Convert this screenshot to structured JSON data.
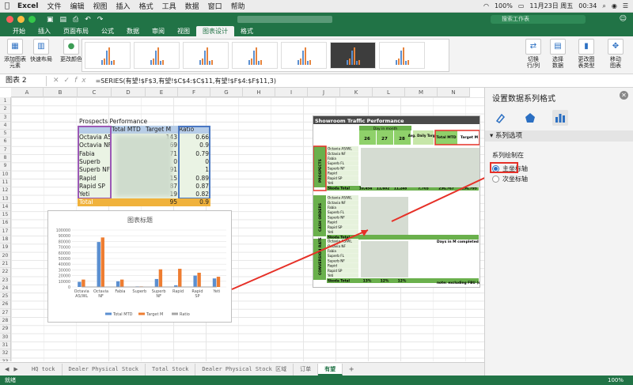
{
  "menubar": {
    "app": "Excel",
    "items": [
      "文件",
      "编辑",
      "视图",
      "插入",
      "格式",
      "工具",
      "数据",
      "窗口",
      "帮助"
    ],
    "battery": "100%",
    "date": "11月23日 周五",
    "time": "00:34"
  },
  "titlebar": {
    "search_placeholder": "搜索工作表"
  },
  "tabs": [
    "开始",
    "插入",
    "页面布局",
    "公式",
    "数据",
    "审阅",
    "视图",
    "图表设计",
    "格式"
  ],
  "active_tab": "图表设计",
  "ribbon": {
    "add_element": "添加图表\n元素",
    "quick_layout": "快速布局",
    "change_colors": "更改颜色",
    "switch_rowcol": "切换\n行/列",
    "select_data": "选择\n数据",
    "change_type": "更改图\n表类型",
    "move_chart": "移动\n图表"
  },
  "formula_bar": {
    "name_box": "图表 2",
    "formula": "=SERIES(有望!$F$3,有望!$C$4:$C$11,有望!$F$4:$F$11,3)"
  },
  "columns": [
    "A",
    "B",
    "C",
    "D",
    "E",
    "F",
    "G",
    "H",
    "I",
    "J",
    "K",
    "L",
    "M",
    "N"
  ],
  "rows": [
    "1",
    "2",
    "3",
    "4",
    "5",
    "6",
    "7",
    "8",
    "9",
    "10",
    "11",
    "12",
    "13",
    "14",
    "15",
    "16",
    "17",
    "18",
    "19",
    "20",
    "21",
    "22",
    "23",
    "24",
    "25",
    "26",
    "27",
    "28",
    "29",
    "30",
    "31",
    "32",
    "33"
  ],
  "table": {
    "title": "Prospects Performance",
    "headers": [
      "Total MTD",
      "Target M",
      "Ratio"
    ],
    "names": [
      "Octavia A5/",
      "Octavia NF",
      "Fabia",
      "Superb",
      "Superb NF",
      "Rapid",
      "Rapid SP",
      "Yeti"
    ],
    "targets": [
      "143",
      "69",
      "71",
      "0",
      "91",
      "15",
      "87",
      "19"
    ],
    "ratios": [
      "0.66",
      "0.9",
      "0.79",
      "0",
      "1",
      "0.89",
      "0.87",
      "0.82"
    ],
    "total_label": "Total",
    "total_target": "95",
    "total_ratio": "0.9"
  },
  "chart_data": {
    "type": "bar",
    "title": "图表标题",
    "categories": [
      "Octavia AS/WL",
      "Octavia NF",
      "Fabia",
      "Superb",
      "Superb NF",
      "Rapid",
      "Rapid SP",
      "Yeti"
    ],
    "ylim": [
      0,
      100000
    ],
    "yticks": [
      "0",
      "10000",
      "20000",
      "30000",
      "40000",
      "50000",
      "60000",
      "70000",
      "80000",
      "90000",
      "100000"
    ],
    "series": [
      {
        "name": "Total MTD",
        "color": "#5b8fd0",
        "values": [
          9000,
          79000,
          10000,
          1000,
          14000,
          3000,
          20000,
          15000
        ]
      },
      {
        "name": "Target M",
        "color": "#ee7d31",
        "values": [
          13000,
          87000,
          13000,
          1000,
          31000,
          32000,
          25000,
          18000
        ]
      },
      {
        "name": "Ratio",
        "color": "#a5a5a5",
        "values": [
          0.66,
          0.9,
          0.79,
          0,
          1,
          0.89,
          0.87,
          0.82
        ]
      }
    ],
    "legend": "bottom"
  },
  "report": {
    "title": "Showroom Traffic Performance",
    "day_header": "Day in month",
    "days": [
      "26",
      "27",
      "28"
    ],
    "avg": "Avg. Daily Target",
    "total_mtd": "Total MTD",
    "target_m": "Target M",
    "sections": [
      "PROSPECTS",
      "CASH ORDERS",
      "CONVERSION RATE"
    ],
    "models": [
      "Octavia AS/WL",
      "Octavia NF",
      "Fabia",
      "Superb FL",
      "Superb NF",
      "Rapid",
      "Rapid SP",
      "Yeti"
    ],
    "skoda_total": "Skoda Total",
    "prospect_totals": [
      "10,454",
      "11,602",
      "11,248",
      "7,703",
      "236,767",
      "256,795"
    ],
    "conv_totals": [
      "13%",
      "12%",
      "12%"
    ],
    "days_completed": "Days in M completed",
    "note": "note: excluding FBU (se"
  },
  "sheet_tabs": [
    "HQ tock",
    "Dealer Physical Stock",
    "Total Stock",
    "Dealer Physical Stock 区域",
    "订单",
    "有望"
  ],
  "active_sheet": "有望",
  "status": {
    "ready": "就绪",
    "zoom": "100%"
  },
  "pane": {
    "title": "设置数据系列格式",
    "section": "系列选项",
    "plot_on": "系列绘制在",
    "primary": "主坐标轴",
    "secondary": "次坐标轴"
  }
}
